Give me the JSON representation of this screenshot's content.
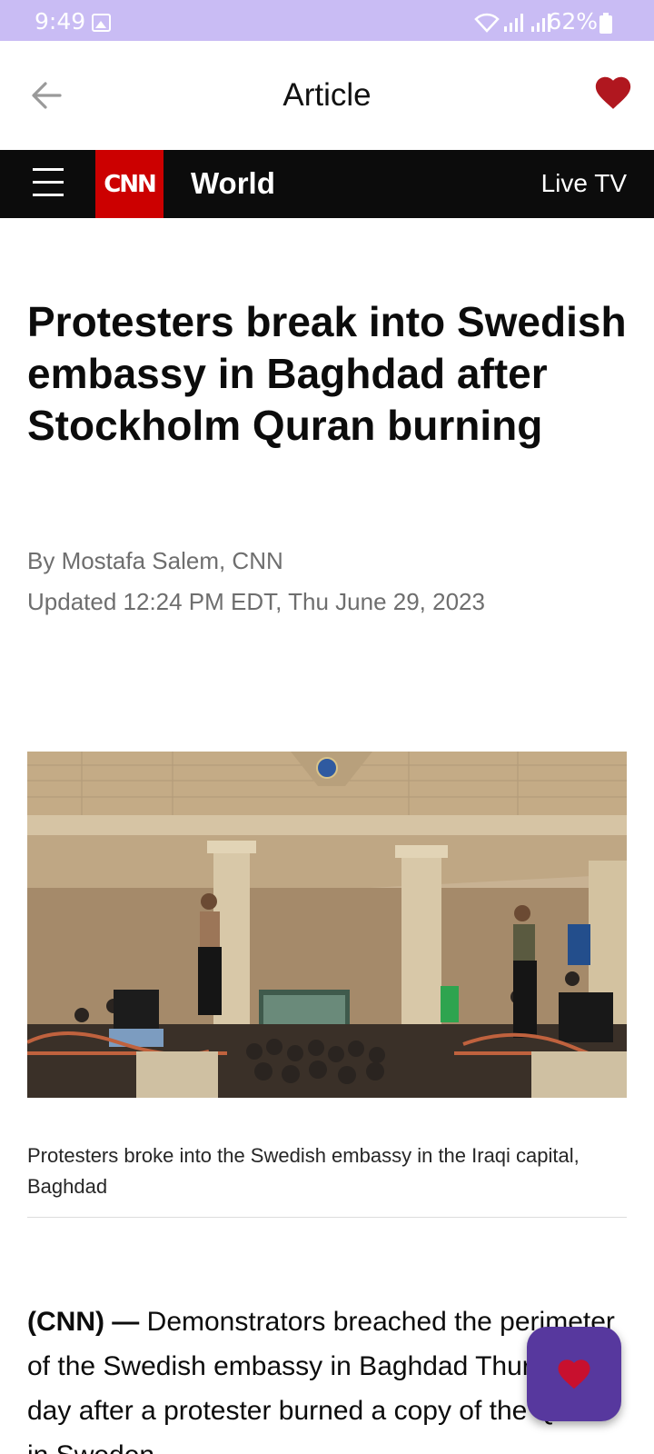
{
  "status_bar": {
    "time": "9:49",
    "battery": "62%"
  },
  "app_bar": {
    "title": "Article"
  },
  "cnn_header": {
    "logo": "CNN",
    "section": "World",
    "live_tv": "Live TV"
  },
  "article": {
    "headline": "Protesters break into Swedish embassy in Baghdad after Stockholm Quran burning",
    "byline": "By Mostafa Salem, CNN",
    "updated": "Updated 12:24 PM EDT, Thu June 29, 2023",
    "image_caption": "Protesters broke into the Swedish embassy in the Iraqi capital, Baghdad",
    "body_lead": "(CNN) —",
    "body_text": " Demonstrators breached the perimeter of the Swedish embassy in Baghdad Thursday, a day after a protester burned a copy of the Quran in Sweden"
  },
  "colors": {
    "status_bar": "#c9bcf4",
    "heart_red": "#b0171f",
    "cnn_red": "#cc0000",
    "fab_purple": "#57389e"
  },
  "icons": {
    "back": "arrow-left-icon",
    "favorite": "heart-icon",
    "menu": "hamburger-menu-icon",
    "fab": "heart-icon"
  }
}
